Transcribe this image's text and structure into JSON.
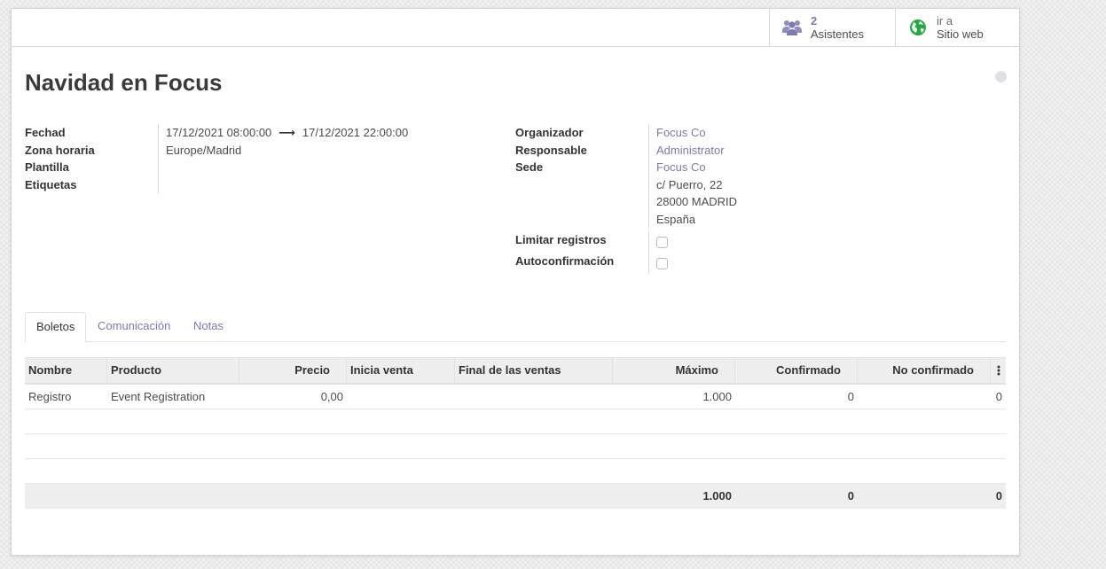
{
  "stat_buttons": {
    "attendees": {
      "count": "2",
      "label": "Asistentes",
      "icon": "users-icon",
      "icon_color": "#7c7bad"
    },
    "website": {
      "line1": "ir a",
      "line2": "Sitio web",
      "icon": "globe-icon",
      "icon_color": "#28a745"
    }
  },
  "record": {
    "title": "Navidad en Focus"
  },
  "left_fields": {
    "date_label": "Fechad",
    "date_begin": "17/12/2021 08:00:00",
    "date_end": "17/12/2021 22:00:00",
    "tz_label": "Zona horaria",
    "tz_value": "Europe/Madrid",
    "template_label": "Plantilla",
    "tags_label": "Etiquetas"
  },
  "right_fields": {
    "organizer_label": "Organizador",
    "organizer_value": "Focus Co",
    "responsible_label": "Responsable",
    "responsible_value": "Administrator",
    "venue_label": "Sede",
    "venue_name": "Focus Co",
    "venue_street": "c/ Puerro, 22",
    "venue_city": "28000 MADRID",
    "venue_country": "España",
    "limit_label": "Limitar registros",
    "autoconfirm_label": "Autoconfirmación"
  },
  "tabs": [
    {
      "label": "Boletos",
      "active": true
    },
    {
      "label": "Comunicación",
      "active": false
    },
    {
      "label": "Notas",
      "active": false
    }
  ],
  "tickets_table": {
    "columns": [
      "Nombre",
      "Producto",
      "Precio",
      "Inicia venta",
      "Final de las ventas",
      "Máximo",
      "Confirmado",
      "No confirmado"
    ],
    "rows": [
      [
        "Registro",
        "Event Registration",
        "0,00",
        "",
        "",
        "1.000",
        "0",
        "0"
      ]
    ],
    "totals": {
      "max": "1.000",
      "confirmed": "0",
      "unconfirmed": "0"
    }
  },
  "colors": {
    "link": "#7c7bad",
    "header_bg": "#eeeeee"
  }
}
